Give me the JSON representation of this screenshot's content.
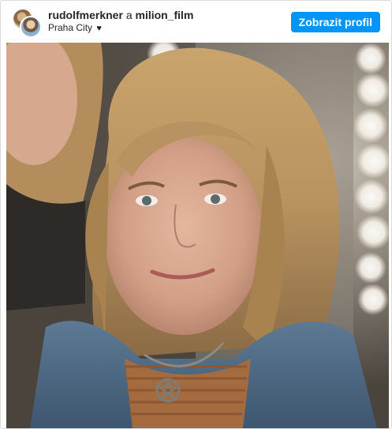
{
  "post": {
    "author_primary": "rudolfmerkner",
    "connector": "a",
    "author_secondary": "milion_film",
    "location": "Praha City",
    "location_suffix_icon": "heart-icon",
    "view_profile_label": "Zobrazit profil"
  },
  "colors": {
    "button_bg": "#0095f6",
    "button_text": "#ffffff",
    "text": "#262626",
    "border": "#dbdbdb"
  },
  "photo": {
    "icon": "portrait-photo"
  }
}
